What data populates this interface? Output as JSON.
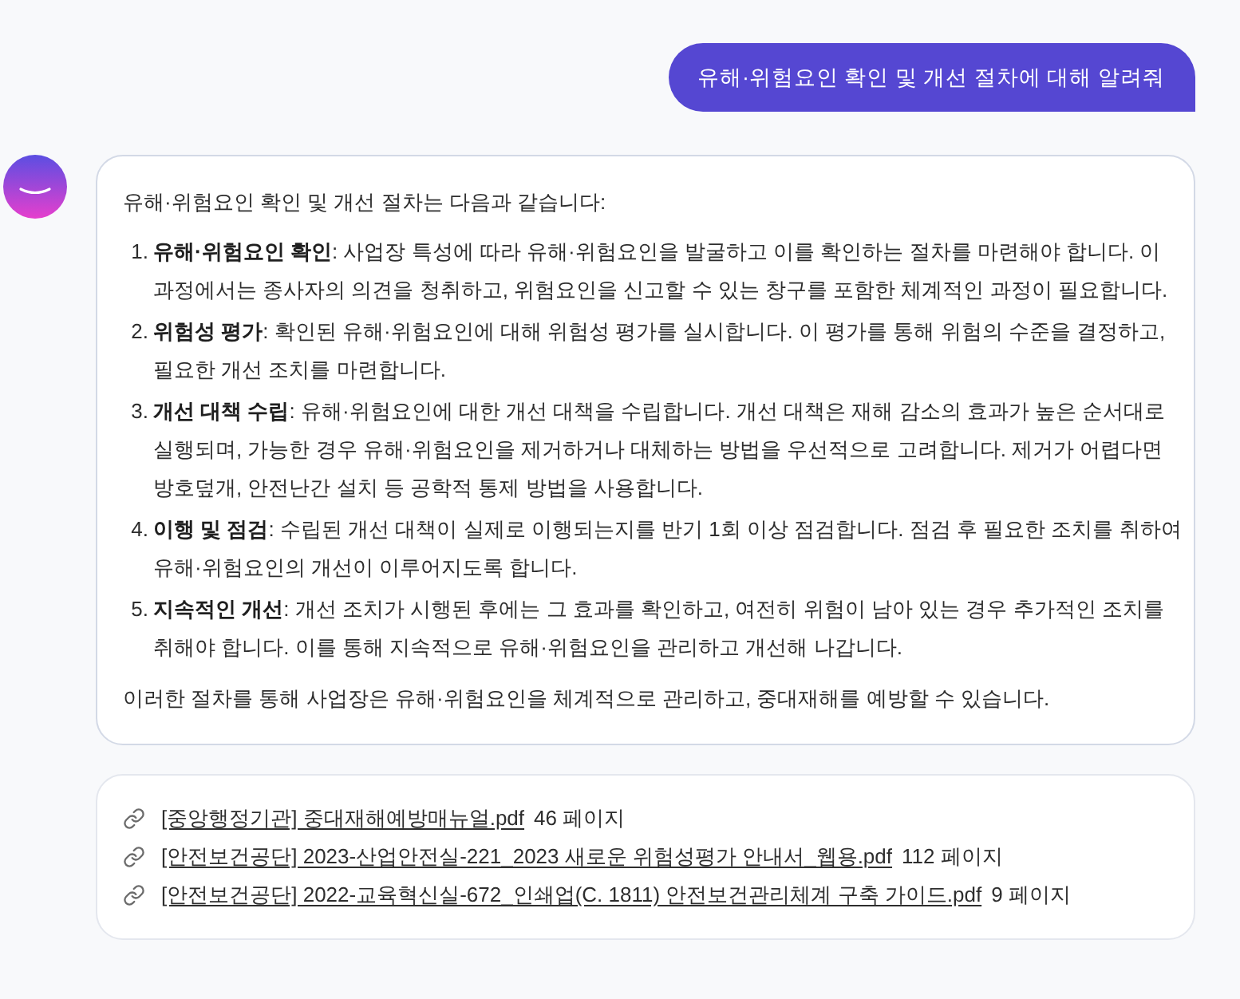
{
  "user_message": {
    "text": "유해·위험요인 확인 및 개선 절차에 대해 알려줘"
  },
  "answer": {
    "intro": "유해·위험요인 확인 및 개선 절차는 다음과 같습니다:",
    "steps": [
      {
        "number": "1.",
        "text": "**유해·위험요인 확인**: 사업장 특성에 따라 유해·위험요인을 발굴하고 이를 확인하는 절차를 마련해야 합니다. 이 과정에서는 종사자의 의견을 청취하고, 위험요인을 신고할 수 있는 창구를 포함한 체계적인 과정이 필요합니다."
      },
      {
        "number": "2.",
        "text": "**위험성 평가**: 확인된 유해·위험요인에 대해 위험성 평가를 실시합니다. 이 평가를 통해 위험의 수준을 결정하고, 필요한 개선 조치를 마련합니다."
      },
      {
        "number": "3.",
        "text": "**개선 대책 수립**: 유해·위험요인에 대한 개선 대책을 수립합니다. 개선 대책은 재해 감소의 효과가 높은 순서대로 실행되며, 가능한 경우 유해·위험요인을 제거하거나 대체하는 방법을 우선적으로 고려합니다. 제거가 어렵다면 방호덮개, 안전난간 설치 등 공학적 통제 방법을 사용합니다."
      },
      {
        "number": "4.",
        "text": "**이행 및 점검**: 수립된 개선 대책이 실제로 이행되는지를 반기 1회 이상 점검합니다. 점검 후 필요한 조치를 취하여 유해·위험요인의 개선이 이루어지도록 합니다."
      },
      {
        "number": "5.",
        "text": "**지속적인 개선**: 개선 조치가 시행된 후에는 그 효과를 확인하고, 여전히 위험이 남아 있는 경우 추가적인 조치를 취해야 합니다. 이를 통해 지속적으로 유해·위험요인을 관리하고 개선해 나갑니다."
      }
    ],
    "conclusion": "이러한 절차를 통해 사업장은 유해·위험요인을 체계적으로 관리하고, 중대재해를 예방할 수 있습니다."
  },
  "sources": [
    {
      "title": "[중앙행정기관] 중대재해예방매뉴얼.pdf",
      "pages": "46 페이지"
    },
    {
      "title": "[안전보건공단] 2023-산업안전실-221_2023 새로운 위험성평가 안내서_웹용.pdf",
      "pages": "112 페이지"
    },
    {
      "title": "[안전보건공단] 2022-교육혁신실-672_인쇄업(C. 1811) 안전보건관리체계 구축 가이드.pdf",
      "pages": "9 페이지"
    }
  ]
}
